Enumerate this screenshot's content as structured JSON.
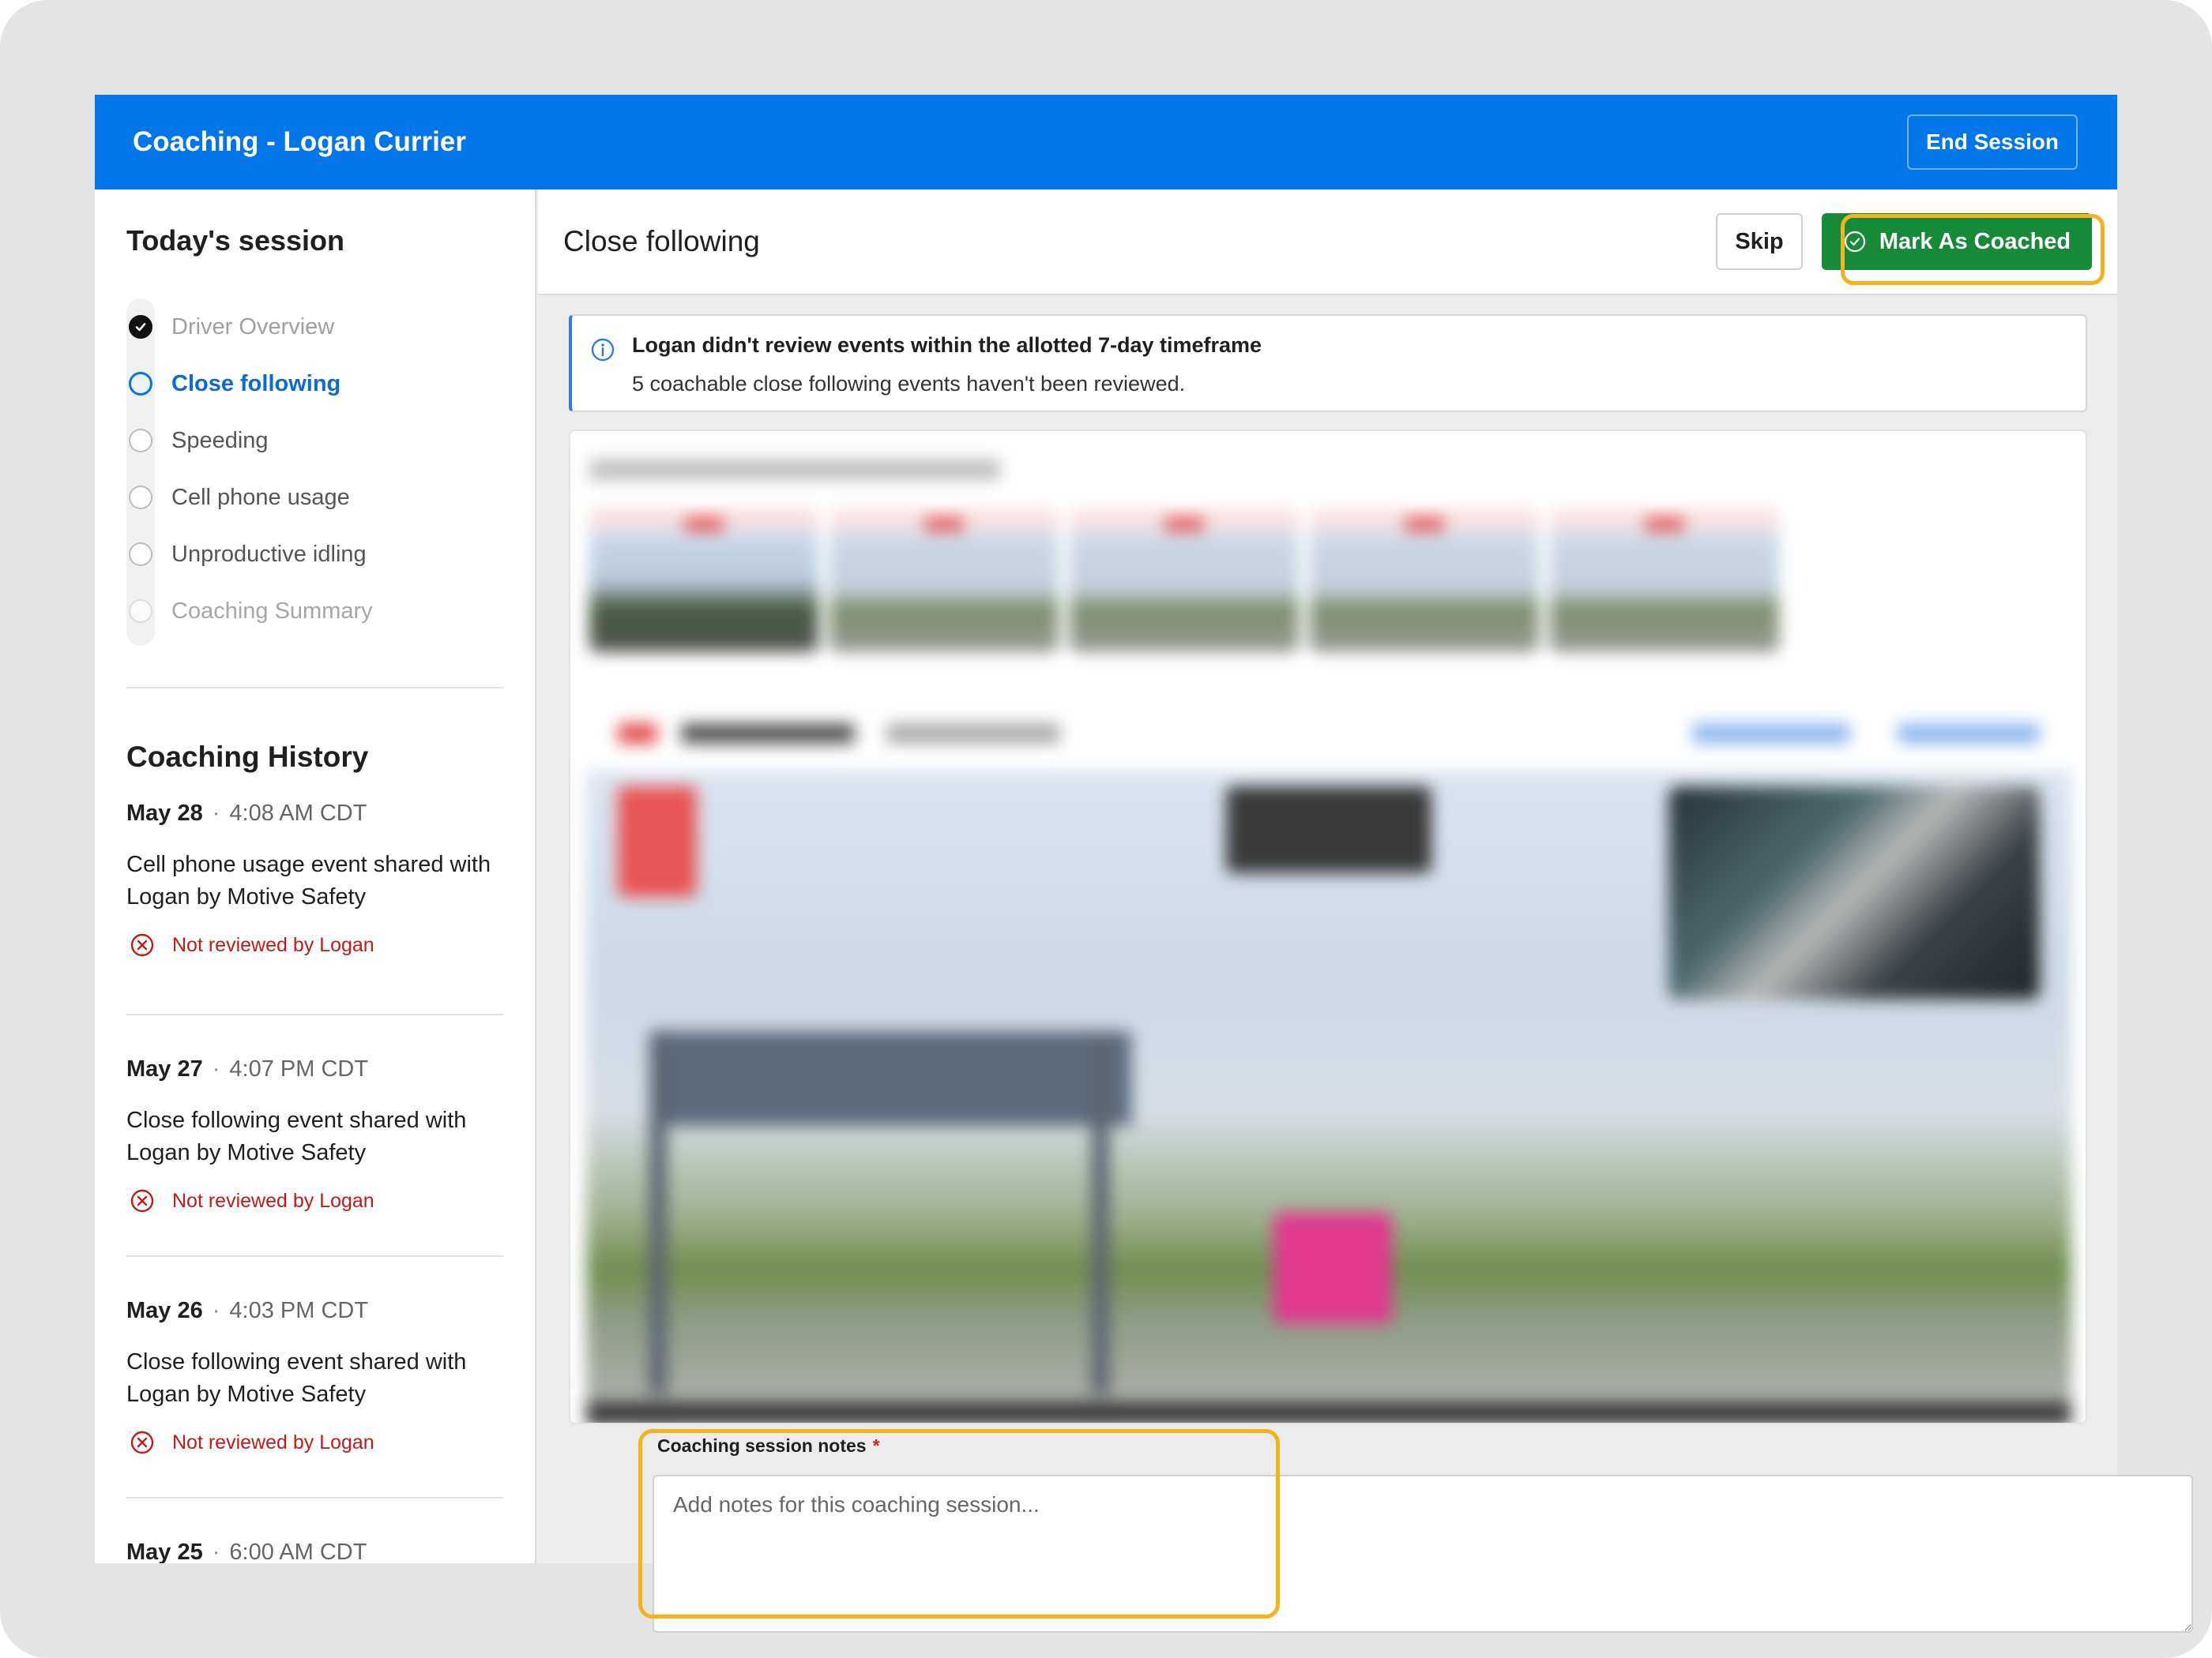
{
  "header": {
    "title": "Coaching - Logan Currier",
    "end_session_label": "End Session"
  },
  "sidebar": {
    "session_heading": "Today's session",
    "steps": [
      {
        "label": "Driver Overview",
        "state": "done"
      },
      {
        "label": "Close following",
        "state": "active"
      },
      {
        "label": "Speeding",
        "state": "pending"
      },
      {
        "label": "Cell phone usage",
        "state": "pending"
      },
      {
        "label": "Unproductive idling",
        "state": "pending"
      },
      {
        "label": "Coaching Summary",
        "state": "faint"
      }
    ],
    "history_heading": "Coaching History",
    "history": [
      {
        "date": "May 28",
        "time": "4:08 AM CDT",
        "description": "Cell phone usage event shared with Logan by Motive Safety",
        "status": "Not reviewed by Logan"
      },
      {
        "date": "May 27",
        "time": "4:07 PM CDT",
        "description": "Close following event shared with Logan by Motive Safety",
        "status": "Not reviewed by Logan"
      },
      {
        "date": "May 26",
        "time": "4:03 PM CDT",
        "description": "Close following event shared with Logan by Motive Safety",
        "status": "Not reviewed by Logan"
      },
      {
        "date": "May 25",
        "time": "6:00 AM CDT",
        "description": "",
        "status": ""
      }
    ]
  },
  "main": {
    "title": "Close following",
    "skip_label": "Skip",
    "mark_coached_label": "Mark As Coached"
  },
  "alert": {
    "title": "Logan didn't review events within the allotted 7-day timeframe",
    "body": "5 coachable close following events haven't been reviewed."
  },
  "notes": {
    "label": "Coaching session notes",
    "required_marker": "*",
    "placeholder": "Add notes for this coaching session...",
    "value": ""
  },
  "colors": {
    "brand_blue": "#0276e8",
    "success_green": "#178a3a",
    "highlight_orange": "#f5b21b",
    "error_red": "#c21b17"
  }
}
